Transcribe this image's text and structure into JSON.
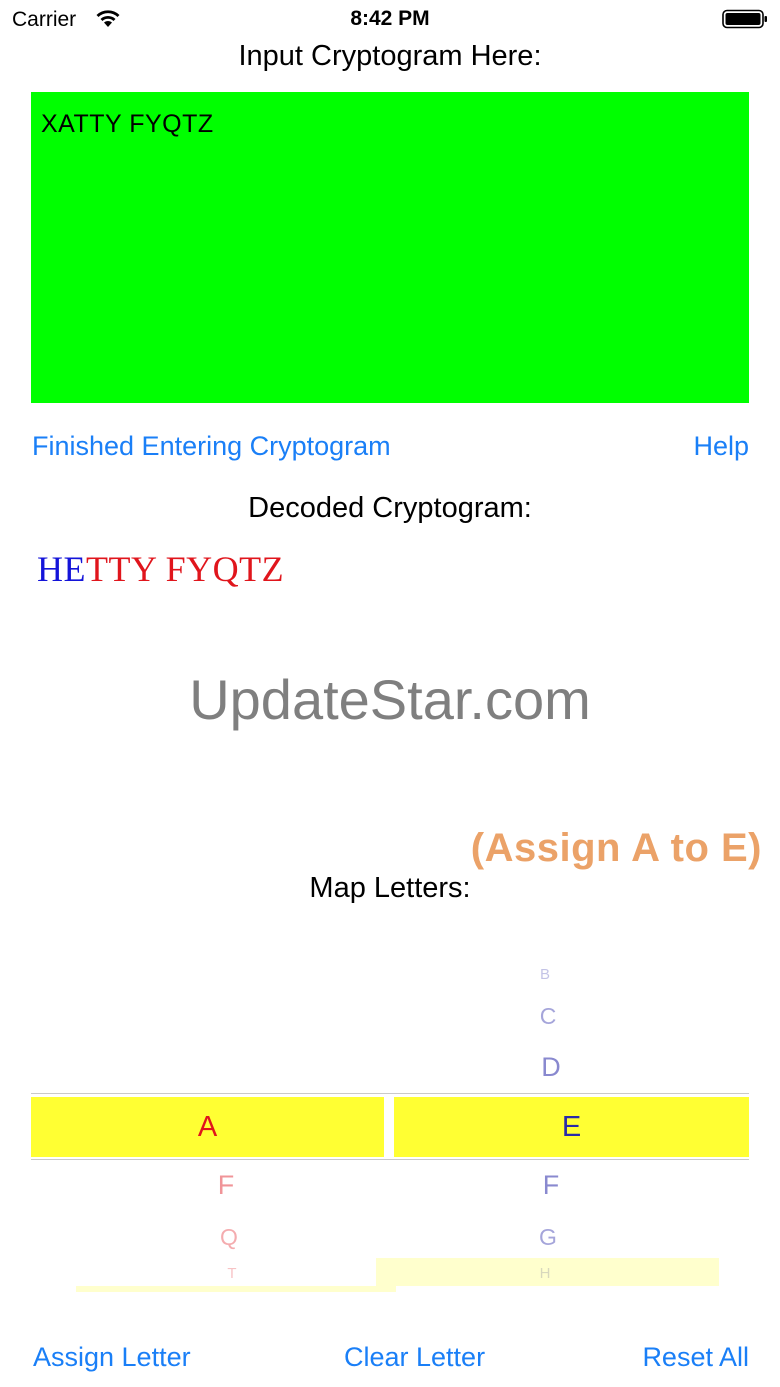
{
  "status_bar": {
    "carrier": "Carrier",
    "time": "8:42 PM"
  },
  "input_heading": "Input Cryptogram Here:",
  "cryptogram_input": "XATTY FYQTZ",
  "links": {
    "finished": "Finished Entering Cryptogram",
    "help": "Help"
  },
  "decoded_heading": "Decoded Cryptogram:",
  "decoded": {
    "solved": "HE",
    "unsolved": "TTY FYQTZ"
  },
  "watermark": "UpdateStar.com",
  "assign_hint": "(Assign A to E)",
  "map_heading": "Map Letters:",
  "picker": {
    "left_column": {
      "selected": "A",
      "below": [
        "F",
        "Q",
        "T"
      ]
    },
    "right_column": {
      "above": [
        "B",
        "C",
        "D"
      ],
      "selected": "E",
      "below": [
        "F",
        "G",
        "H"
      ]
    }
  },
  "bottom_bar": {
    "assign": "Assign Letter",
    "clear": "Clear Letter",
    "reset": "Reset All"
  },
  "colors": {
    "input_background": "#00ff00",
    "selection_highlight": "#ffff33",
    "link": "#1a7ff7",
    "solved_letter": "#1414d9",
    "unsolved_letter": "#e0151c",
    "hint": "#eba268"
  }
}
